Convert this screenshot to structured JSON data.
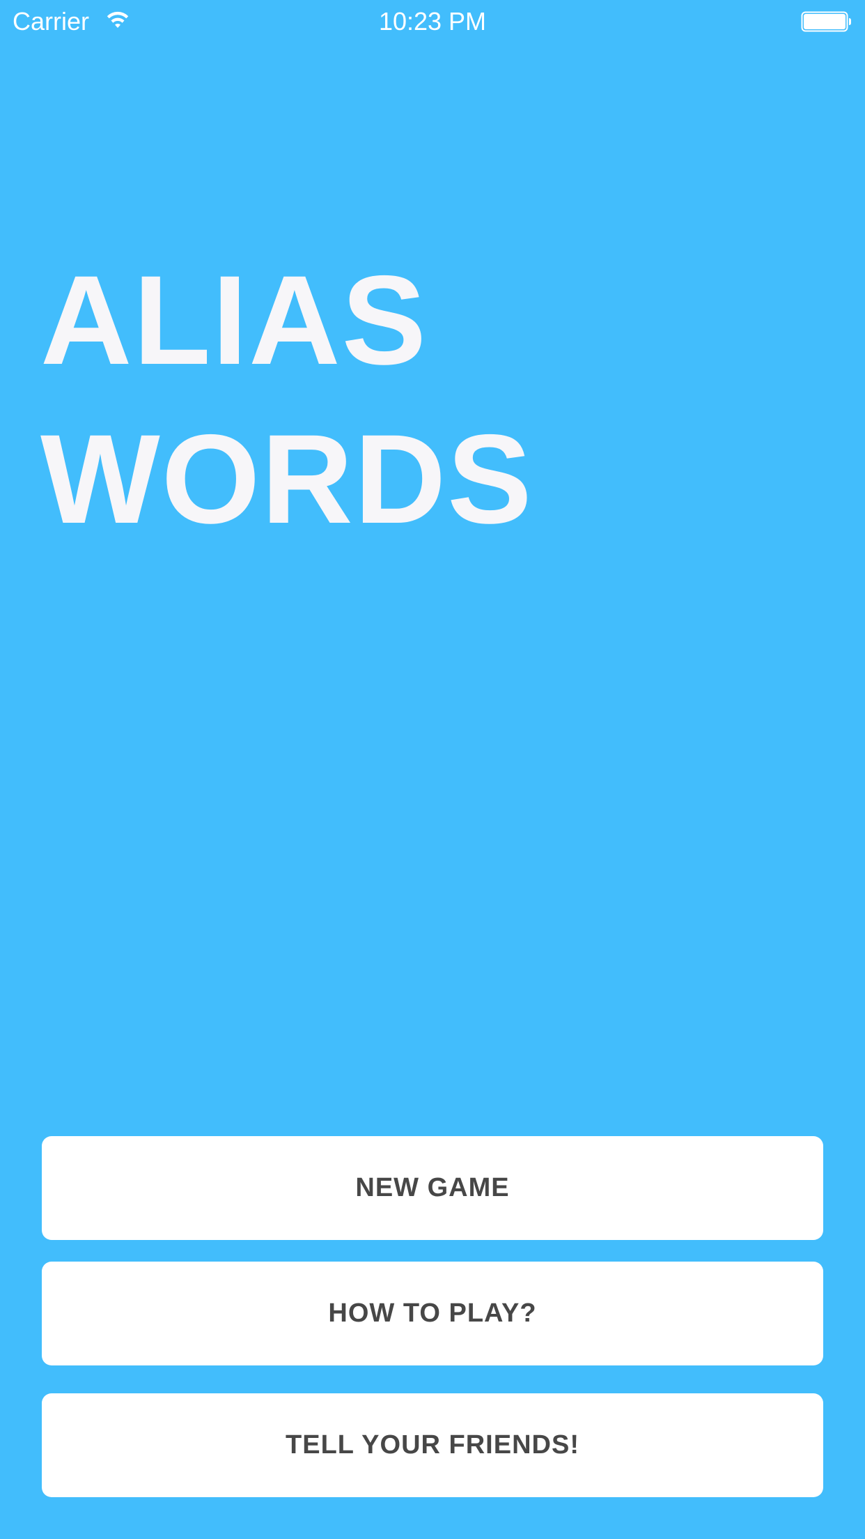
{
  "status_bar": {
    "carrier": "Carrier",
    "time": "10:23 PM",
    "wifi_icon": "wifi-icon",
    "battery_icon": "battery-icon"
  },
  "title": {
    "line1": "ALIAS",
    "line2": "WORDS"
  },
  "menu": {
    "new_game": "NEW GAME",
    "how_to_play": "HOW TO PLAY?",
    "tell_friends": "TELL YOUR FRIENDS!"
  },
  "colors": {
    "background": "#42bdfc",
    "title_text": "#f7f6f9",
    "button_bg": "#ffffff",
    "button_text": "#474747"
  }
}
